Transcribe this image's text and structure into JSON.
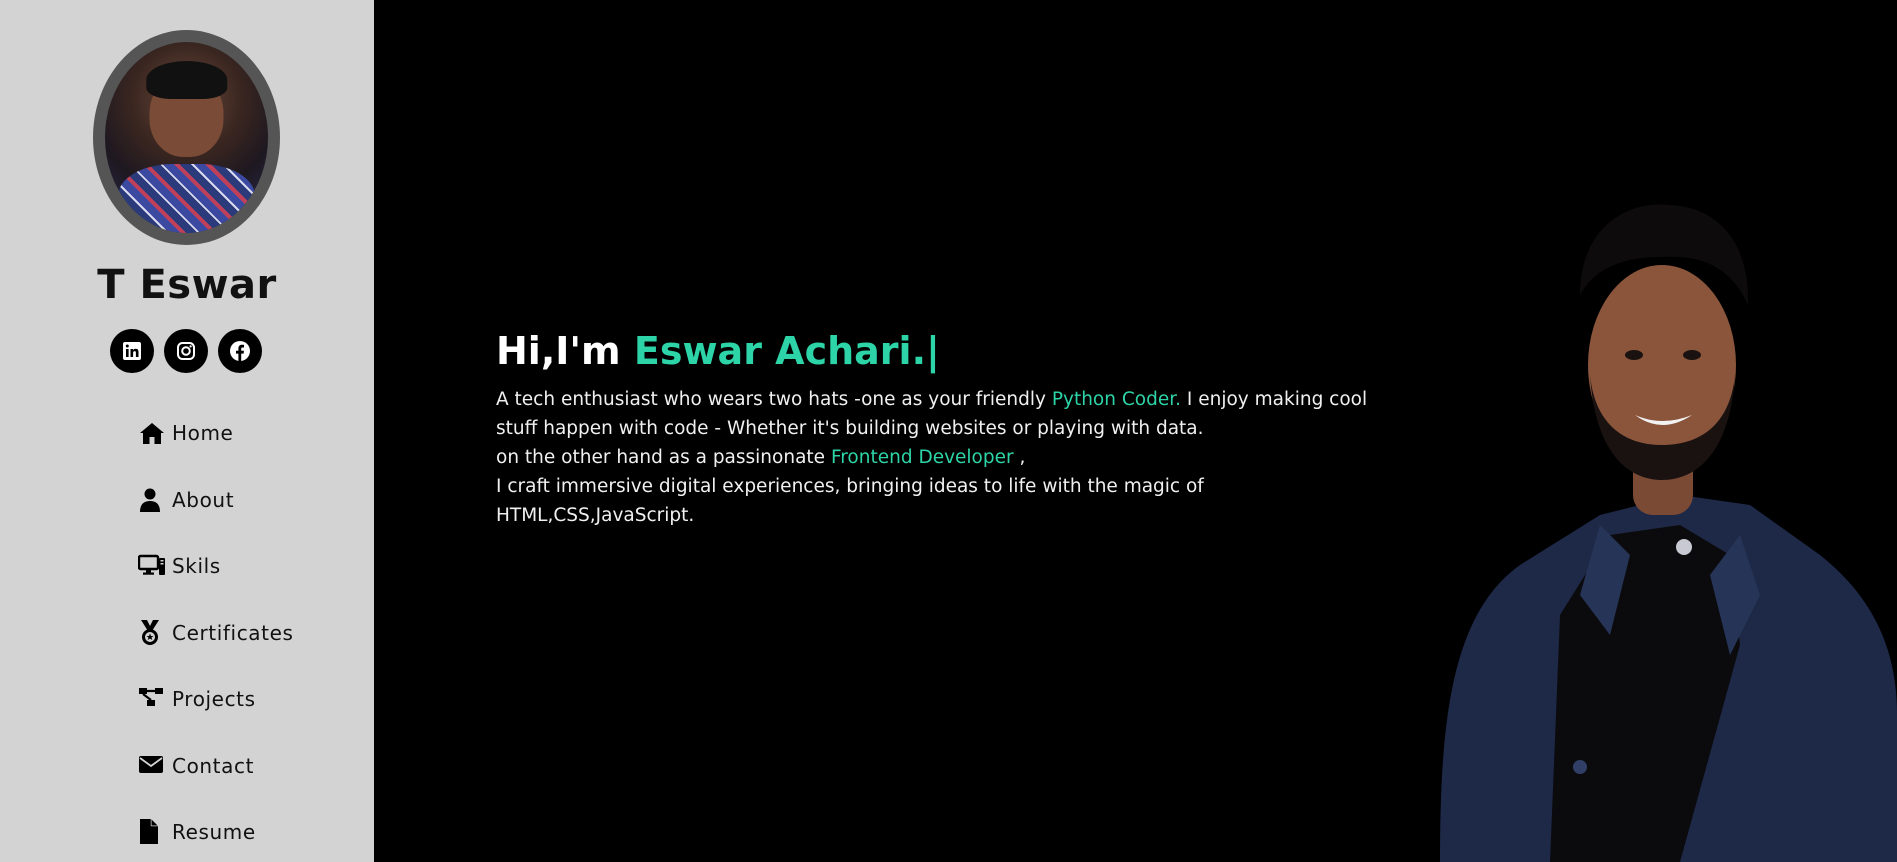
{
  "sidebar": {
    "name": "T Eswar",
    "socials": [
      {
        "icon": "linkedin-icon"
      },
      {
        "icon": "instagram-icon"
      },
      {
        "icon": "facebook-icon"
      }
    ],
    "nav": [
      {
        "label": "Home",
        "icon": "home-icon"
      },
      {
        "label": "About",
        "icon": "user-icon"
      },
      {
        "label": "Skils",
        "icon": "desktop-icon"
      },
      {
        "label": "Certificates",
        "icon": "medal-icon"
      },
      {
        "label": "Projects",
        "icon": "sitemap-icon"
      },
      {
        "label": "Contact",
        "icon": "envelope-icon"
      },
      {
        "label": "Resume",
        "icon": "file-icon"
      }
    ]
  },
  "hero": {
    "greeting": "Hi,I'm",
    "name": "Eswar Achari.",
    "cursor": "|",
    "line1_a": "A tech enthusiast who wears two hats -one as your friendly ",
    "line1_accent": "Python Coder.",
    "line1_b": " I enjoy making cool stuff happen with code - Whether it's building websites or playing with data.",
    "line2_a": "on the other hand as a passinonate ",
    "line2_accent": "Frontend Developer",
    "line2_b": " ,",
    "line3": "I craft immersive digital experiences, bringing ideas to life with the magic of HTML,CSS,JavaScript."
  },
  "colors": {
    "accent": "#2dd4a7",
    "sidebar_bg": "#d3d3d3",
    "main_bg": "#000000"
  }
}
